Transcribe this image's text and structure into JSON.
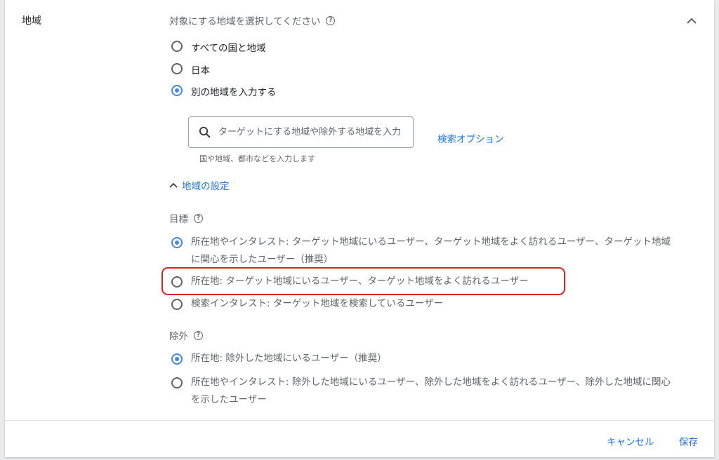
{
  "section": {
    "label": "地域",
    "prompt": "対象にする地域を選択してください"
  },
  "location_options": [
    {
      "label": "すべての国と地域",
      "selected": false
    },
    {
      "label": "日本",
      "selected": false
    },
    {
      "label": "別の地域を入力する",
      "selected": true
    }
  ],
  "search": {
    "placeholder": "ターゲットにする地域や除外する地域を入力",
    "hint": "国や地域、都市などを入力します",
    "options_link": "検索オプション"
  },
  "settings_toggle": "地域の設定",
  "target": {
    "heading": "目標",
    "options": [
      {
        "label": "所在地やインタレスト: ターゲット地域にいるユーザー、ターゲット地域をよく訪れるユーザー、ターゲット地域に関心を示したユーザー（推奨）",
        "selected": true
      },
      {
        "label": "所在地: ターゲット地域にいるユーザー、ターゲット地域をよく訪れるユーザー",
        "selected": false
      },
      {
        "label": "検索インタレスト: ターゲット地域を検索しているユーザー",
        "selected": false
      }
    ]
  },
  "exclude": {
    "heading": "除外",
    "options": [
      {
        "label": "所在地: 除外した地域にいるユーザー（推奨）",
        "selected": true
      },
      {
        "label": "所在地やインタレスト: 除外した地域にいるユーザー、除外した地域をよく訪れるユーザー、除外した地域に関心を示したユーザー",
        "selected": false
      }
    ]
  },
  "footer": {
    "cancel": "キャンセル",
    "save": "保存"
  },
  "colors": {
    "accent": "#1a73e8",
    "radio_selected": "#4285f4",
    "highlight": "#e0201b"
  }
}
